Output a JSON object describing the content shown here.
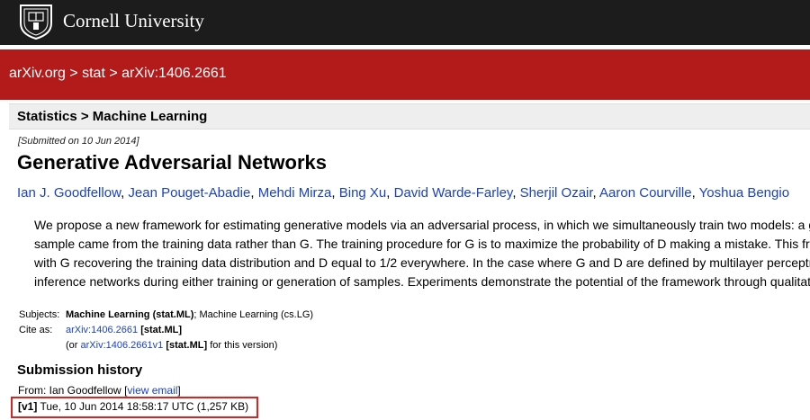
{
  "header": {
    "brand": "Cornell University"
  },
  "breadcrumb": {
    "items": [
      "arXiv.org",
      "stat",
      "arXiv:1406.2661"
    ],
    "separator": ">"
  },
  "subject_bar": {
    "text": "Statistics > Machine Learning"
  },
  "paper": {
    "submitted": "[Submitted on 10 Jun 2014]",
    "title": "Generative Adversarial Networks",
    "authors": [
      "Ian J. Goodfellow",
      "Jean Pouget-Abadie",
      "Mehdi Mirza",
      "Bing Xu",
      "David Warde-Farley",
      "Sherjil Ozair",
      "Aaron Courville",
      "Yoshua Bengio"
    ],
    "abstract_lines": [
      "We propose a new framework for estimating generative models via an adversarial process, in which we simultaneously train two models: a generative mo",
      "sample came from the training data rather than G. The training procedure for G is to maximize the probability of D making a mistake. This framework corr",
      "with G recovering the training data distribution and D equal to 1/2 everywhere. In the case where G and D are defined by multilayer perceptrons, the entir",
      "inference networks during either training or generation of samples. Experiments demonstrate the potential of the framework through qualitative and quant"
    ]
  },
  "meta": {
    "subjects_label": "Subjects:",
    "subjects_primary": "Machine Learning (stat.ML)",
    "subjects_rest": "; Machine Learning (cs.LG)",
    "cite_label": "Cite as:",
    "cite_id": "arXiv:1406.2661",
    "cite_tag": "[stat.ML]",
    "version_prefix": "(or",
    "version_id": "arXiv:1406.2661v1",
    "version_tag": "[stat.ML]",
    "version_suffix": "for this version)"
  },
  "history": {
    "heading": "Submission history",
    "from_label": "From: Ian Goodfellow",
    "view_email_open": "[",
    "view_email": "view email",
    "view_email_close": "]",
    "v1_label": "[v1]",
    "v1_detail": "Tue, 10 Jun 2014 18:58:17 UTC (1,257 KB)"
  },
  "colors": {
    "topbar": "#1c1c1c",
    "redbar": "#b31b1b",
    "link": "#1a41c9",
    "highlight": "#dd2222"
  }
}
